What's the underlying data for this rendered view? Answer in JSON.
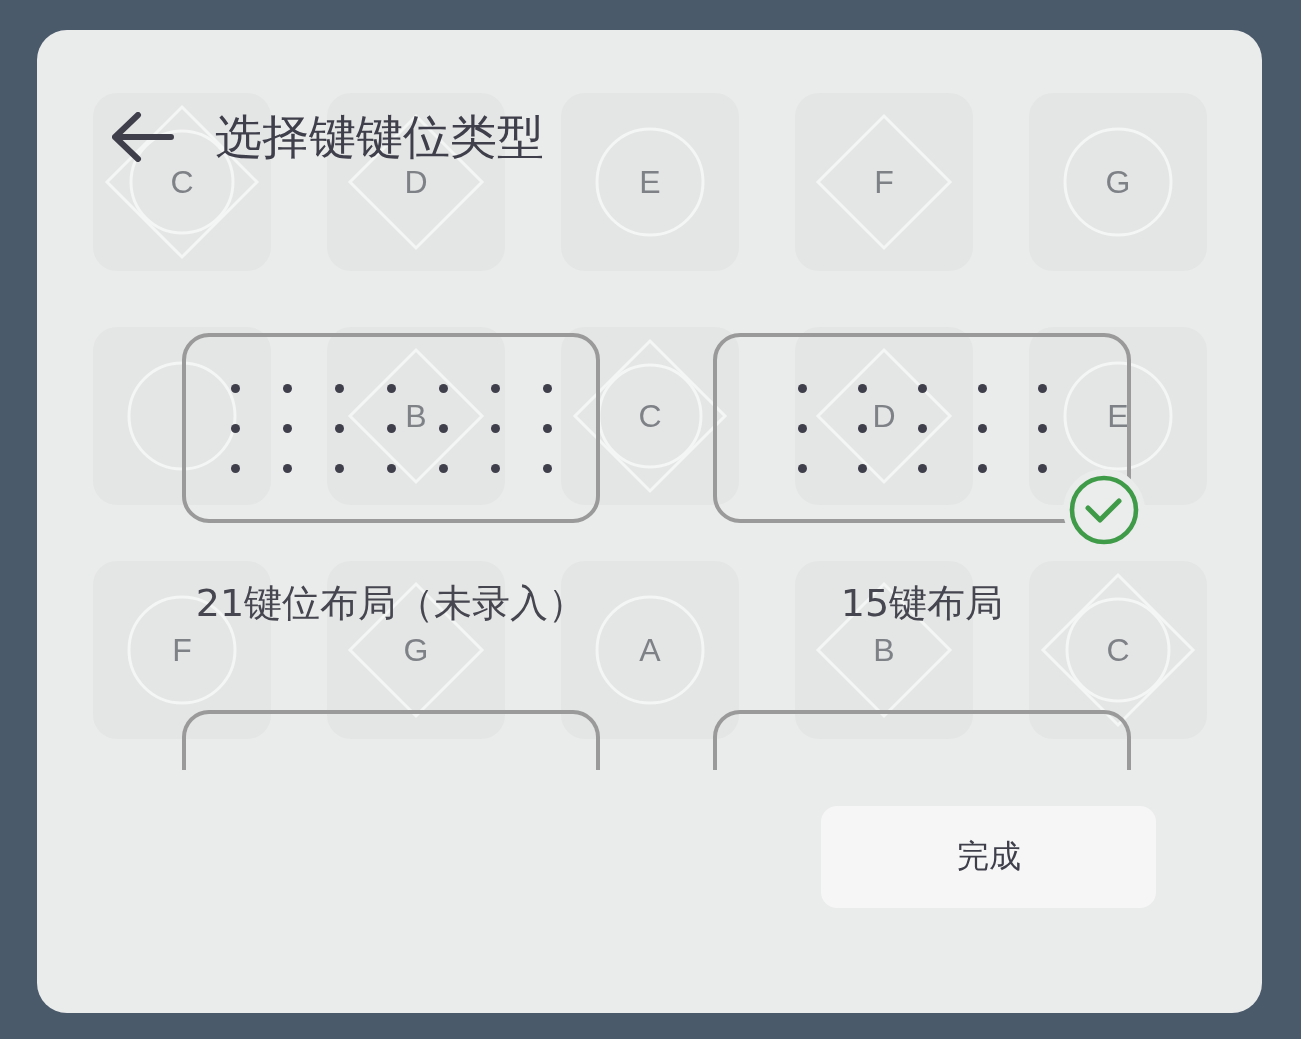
{
  "dialog": {
    "title": "选择键键位类型",
    "done_button": "完成"
  },
  "backdrop_keys": [
    {
      "label": "C",
      "kind": "both"
    },
    {
      "label": "D",
      "kind": "diamond"
    },
    {
      "label": "E",
      "kind": "circle"
    },
    {
      "label": "F",
      "kind": "diamond"
    },
    {
      "label": "G",
      "kind": "circle"
    },
    {
      "kind": "circle"
    },
    {
      "label": "B",
      "kind": "diamond"
    },
    {
      "label": "C",
      "kind": "both"
    },
    {
      "label": "D",
      "kind": "diamond"
    },
    {
      "label": "E",
      "kind": "circle"
    },
    {
      "label": "F",
      "kind": "circle"
    },
    {
      "label": "G",
      "kind": "diamond"
    },
    {
      "label": "A",
      "kind": "circle"
    },
    {
      "label": "B",
      "kind": "diamond"
    },
    {
      "label": "C",
      "kind": "both"
    }
  ],
  "layouts": [
    {
      "kind": "dense",
      "label": "21键位布局（未录入）",
      "selected": false
    },
    {
      "kind": "sparse",
      "label": "15键布局",
      "selected": true
    },
    {
      "kind": "clipped"
    },
    {
      "kind": "clipped"
    }
  ]
}
